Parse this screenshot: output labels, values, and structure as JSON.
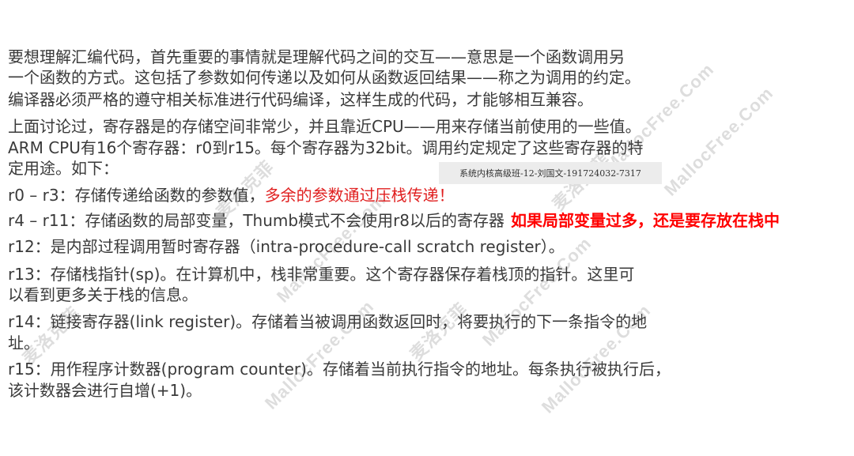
{
  "lines": [
    {
      "text": "要想理解汇编代码，首先重要的事情就是理解代码之间的交互——意思是一个函数调用另"
    },
    {
      "text": "一个函数的方式。这包括了参数如何传递以及如何从函数返回结果——称之为调用的约定。"
    },
    {
      "text": "编译器必须严格的遵守相关标准进行代码编译，这样生成的代码，才能够相互兼容。"
    },
    {
      "text": "上面讨论过，寄存器是的存储空间非常少，并且靠近CPU——用来存储当前使用的一些值。"
    },
    {
      "text": "ARM CPU有16个寄存器：r0到r15。每个寄存器为32bit。调用约定规定了这些寄存器的特"
    },
    {
      "text": "定用途。如下："
    },
    {
      "text": "r0 – r3：存储传递给函数的参数值，",
      "note": "多余的参数通过压栈传递！"
    },
    {
      "text": "r4 – r11：存储函数的局部变量，Thumb模式不会使用r8以后的寄存器",
      "note": "如果局部变量过多，还是要存放在栈中"
    },
    {
      "text": "r12：是内部过程调用暂时寄存器（intra-procedure-call scratch register）。"
    },
    {
      "text": "r13：存储栈指针(sp)。在计算机中，栈非常重要。这个寄存器保存着栈顶的指针。这里可"
    },
    {
      "text": "以看到更多关于栈的信息。"
    },
    {
      "text": "r14：链接寄存器(link register)。存储着当被调用函数返回时，将要执行的下一条指令的地"
    },
    {
      "text": "址。"
    },
    {
      "text": "r15：用作程序计数器(program counter)。存储着当前执行指令的地址。每条执行被执行后，"
    },
    {
      "text": "该计数器会进行自增(+1)。"
    }
  ],
  "stamp": "系统内核高级班-12-刘国文-191724032-7317",
  "watermark": {
    "latin": "MallocFree.Com",
    "cjk": "麦洛克菲"
  },
  "colors": {
    "body_text": "#3a3a3a",
    "note_red": "#e02020",
    "annotation_red": "#ff0000",
    "stamp_bg": "#ececec"
  }
}
